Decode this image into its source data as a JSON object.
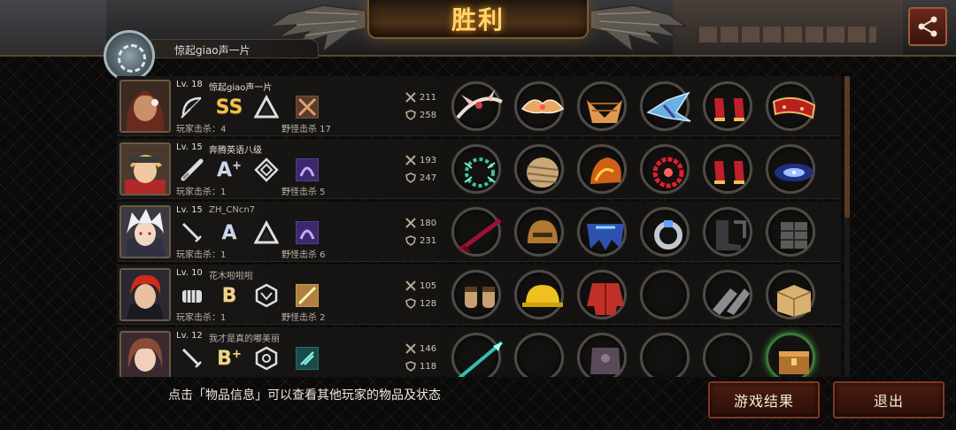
{
  "header": {
    "title": "胜利",
    "top_player_name": "惊起giao声一片"
  },
  "players": [
    {
      "level": "Lv. 18",
      "name": "惊起giao声一片",
      "rank": "SS",
      "rank_plus": "",
      "player_kills": "玩家击杀：4",
      "monster_kills": "野怪击杀 17",
      "attack": "211",
      "defense": "258",
      "weapon_icon": "bow-icon",
      "items": [
        "winged-bow",
        "winged-crown",
        "golden-shoulder-armor",
        "crystal-wings",
        "red-high-heels",
        "red-gold-bracer"
      ]
    },
    {
      "level": "Lv. 15",
      "name": "奔腾英语八级",
      "rank": "A",
      "rank_plus": "+",
      "player_kills": "玩家击杀：1",
      "monster_kills": "野怪击杀 5",
      "attack": "193",
      "defense": "247",
      "weapon_icon": "bat-icon",
      "items": [
        "thorn-crown",
        "bandaged-armor",
        "fire-gauntlet",
        "ruby-necklace",
        "red-high-heels",
        "galaxy-ring"
      ]
    },
    {
      "level": "Lv. 15",
      "name": "ZH_CNcn7",
      "rank": "A",
      "rank_plus": "",
      "player_kills": "玩家击杀：1",
      "monster_kills": "野怪击杀 6",
      "attack": "180",
      "defense": "231",
      "weapon_icon": "sword-icon",
      "items": [
        "crimson-sword",
        "bronze-helmet",
        "blue-cape",
        "silver-ring",
        "dark-boots",
        "stone-armor"
      ]
    },
    {
      "level": "Lv. 10",
      "name": "花木啦啦啦",
      "rank": "B",
      "rank_plus": "",
      "player_kills": "玩家击杀：1",
      "monster_kills": "野怪击杀 2",
      "attack": "105",
      "defense": "128",
      "weapon_icon": "fist-icon",
      "items": [
        "knuckle-gloves",
        "hard-hat",
        "red-jacket",
        "",
        "steel-greaves",
        "cardboard-box"
      ]
    },
    {
      "level": "Lv. 12",
      "name": "我才是真的嘟美丽",
      "rank": "B",
      "rank_plus": "+",
      "player_kills": "",
      "monster_kills": "",
      "attack": "146",
      "defense": "118",
      "weapon_icon": "sword-icon",
      "items": [
        "teal-spear",
        "",
        "dark-armor",
        "",
        "",
        "treasure-box"
      ]
    }
  ],
  "footer": {
    "hint": "点击「物品信息」可以查看其他玩家的物品及状态",
    "result_button": "游戏结果",
    "exit_button": "退出"
  },
  "colors": {
    "title": "#ffd468",
    "button_bg": "#4a1c12",
    "slot_ring": "#4e4a46"
  }
}
